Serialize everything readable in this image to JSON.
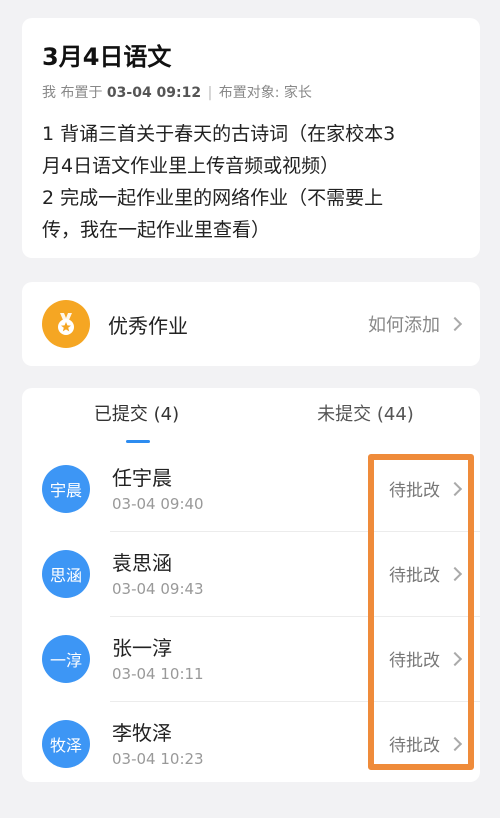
{
  "homework": {
    "title": "3月4日语文",
    "meta_author": "我 布置于",
    "meta_time": "03-04 09:12",
    "meta_sep": "|",
    "meta_target": "布置对象: 家长",
    "content_lines": [
      "1 背诵三首关于春天的古诗词（在家校本3",
      "月4日语文作业里上传音频或视频）",
      "2 完成一起作业里的网络作业（不需要上",
      "传，我在一起作业里查看）"
    ]
  },
  "excellent": {
    "label": "优秀作业",
    "link": "如何添加",
    "icon": "medal-icon",
    "color": "#f5a623"
  },
  "tabs": [
    {
      "label": "已提交 (4)",
      "active": true
    },
    {
      "label": "未提交 (44)",
      "active": false
    }
  ],
  "submissions": [
    {
      "avatar": "宇晨",
      "name": "任宇晨",
      "time": "03-04 09:40",
      "status": "待批改"
    },
    {
      "avatar": "思涵",
      "name": "袁思涵",
      "time": "03-04 09:43",
      "status": "待批改"
    },
    {
      "avatar": "一淳",
      "name": "张一淳",
      "time": "03-04 10:11",
      "status": "待批改"
    },
    {
      "avatar": "牧泽",
      "name": "李牧泽",
      "time": "03-04 10:23",
      "status": "待批改"
    }
  ],
  "colors": {
    "avatar": "#3d96f5",
    "tab_indicator": "#2d8cf0",
    "highlight": "#ef8b3a"
  }
}
